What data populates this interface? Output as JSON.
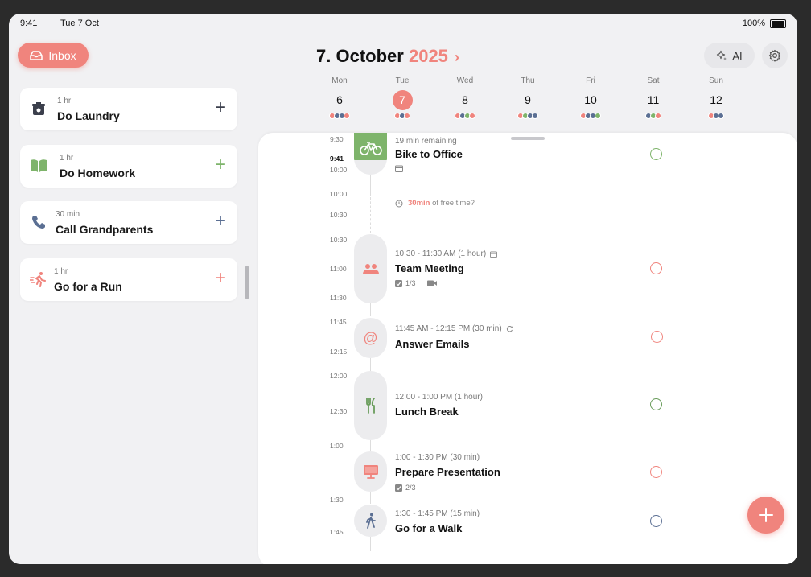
{
  "status_bar": {
    "time": "9:41",
    "date": "Tue 7 Oct",
    "battery": "100%"
  },
  "inbox": {
    "label": "Inbox"
  },
  "inbox_tasks": [
    {
      "duration": "1 hr",
      "title": "Do Laundry",
      "icon": "laundry-basket-icon",
      "color": "#3b3f4c"
    },
    {
      "duration": "1 hr",
      "title": "Do Homework",
      "icon": "book-icon",
      "color": "#7eb46b"
    },
    {
      "duration": "30 min",
      "title": "Call Grandparents",
      "icon": "phone-icon",
      "color": "#5b6f93"
    },
    {
      "duration": "1 hr",
      "title": "Go for a Run",
      "icon": "runner-icon",
      "color": "#f0847d"
    }
  ],
  "header": {
    "day": "7.",
    "month": "October",
    "year": "2025",
    "chevron": "›",
    "ai_label": "AI"
  },
  "week": [
    {
      "name": "Mon",
      "num": "6",
      "dots": [
        "#f0847d",
        "#5b6f93",
        "#5b6f93",
        "#f0847d"
      ]
    },
    {
      "name": "Tue",
      "num": "7",
      "today": true,
      "dots": [
        "#f0847d",
        "#5b6f93",
        "#f0847d"
      ]
    },
    {
      "name": "Wed",
      "num": "8",
      "dots": [
        "#f0847d",
        "#5b6f93",
        "#7eb46b",
        "#f0847d"
      ]
    },
    {
      "name": "Thu",
      "num": "9",
      "dots": [
        "#f0847d",
        "#7eb46b",
        "#5b6f93",
        "#5b6f93"
      ]
    },
    {
      "name": "Fri",
      "num": "10",
      "dots": [
        "#f0847d",
        "#5b6f93",
        "#5b6f93",
        "#7eb46b"
      ]
    },
    {
      "name": "Sat",
      "num": "11",
      "dots": [
        "#5b6f93",
        "#7eb46b",
        "#f0847d"
      ]
    },
    {
      "name": "Sun",
      "num": "12",
      "dots": [
        "#f0847d",
        "#5b6f93",
        "#5b6f93"
      ]
    }
  ],
  "time_labels": [
    "9:30",
    "9:41",
    "10:00",
    "10:00",
    "10:30",
    "10:30",
    "11:00",
    "11:30",
    "11:45",
    "12:15",
    "12:00",
    "12:30",
    "1:00",
    "1:30",
    "1:45"
  ],
  "free_time": {
    "mins": "30min",
    "text": "of free time?"
  },
  "events": [
    {
      "sub": "19 min remaining",
      "title": "Bike to Office",
      "icon": "bicycle-icon",
      "check_color": "#7eb46b"
    },
    {
      "sub": "10:30 - 11:30 AM (1 hour)",
      "title": "Team Meeting",
      "icon": "people-icon",
      "meta": "1/3",
      "check_color": "#f0847d"
    },
    {
      "sub": "11:45 AM - 12:15 PM (30 min)",
      "title": "Answer Emails",
      "icon": "at-sign-icon",
      "check_color": "#f0847d"
    },
    {
      "sub": "12:00 - 1:00 PM (1 hour)",
      "title": "Lunch Break",
      "icon": "fork-knife-icon",
      "check_color": "#6a9d5c"
    },
    {
      "sub": "1:00 - 1:30 PM (30 min)",
      "title": "Prepare Presentation",
      "icon": "monitor-icon",
      "meta": "2/3",
      "check_color": "#f0847d"
    },
    {
      "sub": "1:30 - 1:45 PM (15 min)",
      "title": "Go for a Walk",
      "icon": "walking-icon",
      "check_color": "#5b6f93"
    }
  ],
  "colors": {
    "accent": "#f0847d",
    "green": "#7eb46b",
    "slate": "#5b6f93"
  }
}
